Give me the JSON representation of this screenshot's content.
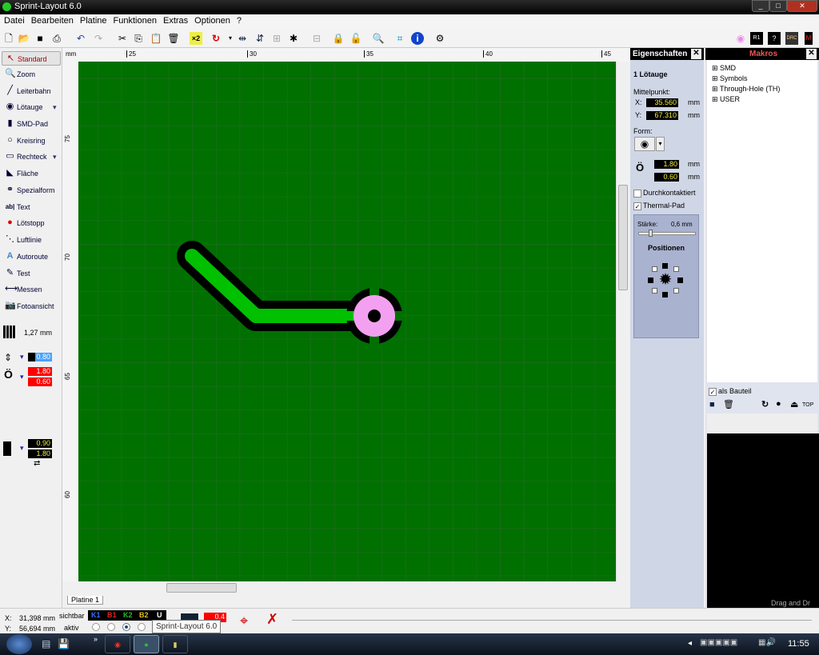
{
  "window": {
    "title": "Sprint-Layout 6.0"
  },
  "menu": [
    "Datei",
    "Bearbeiten",
    "Platine",
    "Funktionen",
    "Extras",
    "Optionen",
    "?"
  ],
  "tools": [
    {
      "label": "Standard",
      "icon": "cursor-icon"
    },
    {
      "label": "Zoom",
      "icon": "zoom-icon"
    },
    {
      "label": "Leiterbahn",
      "icon": "track-icon"
    },
    {
      "label": "Lötauge",
      "icon": "pad-icon"
    },
    {
      "label": "SMD-Pad",
      "icon": "smd-pad-icon"
    },
    {
      "label": "Kreisring",
      "icon": "circle-icon"
    },
    {
      "label": "Rechteck",
      "icon": "rectangle-icon"
    },
    {
      "label": "Fläche",
      "icon": "area-icon"
    },
    {
      "label": "Spezialform",
      "icon": "special-form-icon"
    },
    {
      "label": "Text",
      "icon": "text-icon"
    },
    {
      "label": "Lötstopp",
      "icon": "solder-stop-icon"
    },
    {
      "label": "Luftlinie",
      "icon": "airwire-icon"
    },
    {
      "label": "Autoroute",
      "icon": "autoroute-icon"
    },
    {
      "label": "Test",
      "icon": "test-icon"
    },
    {
      "label": "Messen",
      "icon": "measure-icon"
    },
    {
      "label": "Fotoansicht",
      "icon": "photo-view-icon"
    }
  ],
  "grid": {
    "value": "1,27 mm"
  },
  "track_width": "0.80",
  "pad_outer": "1.80",
  "pad_inner": "0.60",
  "smd_w": "0.90",
  "smd_h": "1.80",
  "ruler": {
    "unit": "mm",
    "h_ticks": [
      "25",
      "30",
      "35",
      "40",
      "45"
    ],
    "v_ticks": [
      "75",
      "70",
      "65",
      "60"
    ]
  },
  "board_tab": "Platine 1",
  "properties": {
    "title": "Eigenschaften",
    "heading": "1 Lötauge",
    "center_label": "Mittelpunkt:",
    "x_label": "X:",
    "x_value": "35.560",
    "y_label": "Y:",
    "y_value": "67.310",
    "unit": "mm",
    "form_label": "Form:",
    "outer": "1.80",
    "inner": "0.60",
    "through_plated": "Durchkontaktiert",
    "through_plated_checked": false,
    "thermal_pad": "Thermal-Pad",
    "thermal_pad_checked": true,
    "strength_label": "Stärke:",
    "strength_value": "0,6 mm",
    "strength_fraction": 0.1,
    "positions_label": "Positionen"
  },
  "makros": {
    "title": "Makros",
    "tree": [
      "SMD",
      "Symbols",
      "Through-Hole (TH)",
      "USER"
    ],
    "as_component": "als Bauteil",
    "top_label": "TOP",
    "drag_hint": "Drag and Dr"
  },
  "status": {
    "x": "X:",
    "x_value": "31,398 mm",
    "y": "Y:",
    "y_value": "56,694 mm",
    "visible": "sichtbar",
    "active": "aktiv",
    "layers": [
      {
        "name": "K1",
        "color": "#3a6cff"
      },
      {
        "name": "B1",
        "color": "#e02020"
      },
      {
        "name": "K2",
        "color": "#20c020"
      },
      {
        "name": "B2",
        "color": "#e0c020"
      },
      {
        "name": "U",
        "color": "#ffffff"
      }
    ],
    "active_layer": "K2",
    "value": "0.4"
  },
  "tooltip": "Sprint-Layout 6.0",
  "taskbar": {
    "clock": "11:55"
  },
  "colors": {
    "board": "#007000",
    "track": "#00c000",
    "pad": "#f4a0f0"
  }
}
